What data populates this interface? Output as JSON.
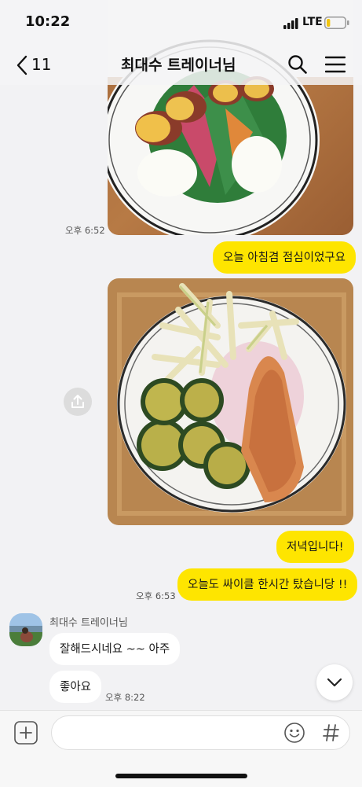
{
  "status": {
    "time": "10:22",
    "network": "LTE",
    "battery_level": 0.2
  },
  "header": {
    "back_count": "11",
    "title": "최대수 트레이너님",
    "icons": [
      "chevron-left-icon",
      "search-icon",
      "menu-icon"
    ]
  },
  "messages": [
    {
      "type": "image",
      "from": "me",
      "time": "오후 6:52",
      "image": "plate-with-sweet-potato-and-boiled-eggs"
    },
    {
      "type": "text",
      "from": "me",
      "text": "오늘 아침겸 점심이었구요"
    },
    {
      "type": "image",
      "from": "me",
      "image": "plate-with-onion-zucchini-and-salmon",
      "share_icon": "share-icon"
    },
    {
      "type": "text",
      "from": "me",
      "text": "저녁입니다!"
    },
    {
      "type": "text",
      "from": "me",
      "text": "오늘도 싸이클 한시간 탔습니당 !!",
      "time": "오후 6:53"
    },
    {
      "type": "text",
      "from": "other",
      "sender": "최대수 트레이너님",
      "text": "잘해드시네요 ~~ 아주"
    },
    {
      "type": "text",
      "from": "other",
      "text": "좋아요",
      "time": "오후 8:22"
    }
  ],
  "input": {
    "value": "",
    "icons": [
      "plus-icon",
      "emoji-icon",
      "hash-icon"
    ]
  },
  "scroll_button_icon": "chevron-down-icon",
  "colors": {
    "my_bubble": "#fee500",
    "other_bubble": "#ffffff",
    "background": "#f2f2f4"
  }
}
